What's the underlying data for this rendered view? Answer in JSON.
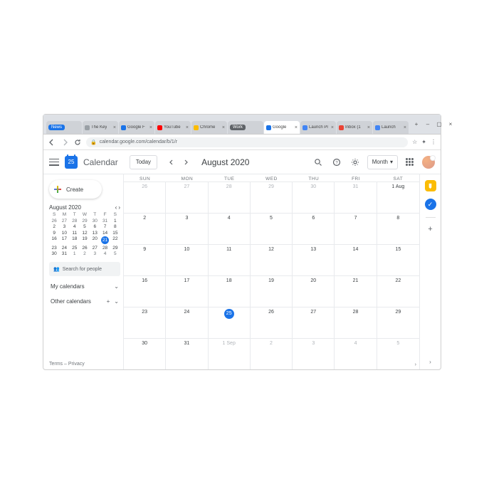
{
  "browser": {
    "tabs": [
      {
        "label": "News",
        "color": "#1a73e8",
        "textcolor": "#fff",
        "pill": true
      },
      {
        "label": "The Key",
        "favicon": "#9aa0a6",
        "close": "×"
      },
      {
        "label": "Google F",
        "favicon": "#1a73e8",
        "close": "×"
      },
      {
        "label": "YouTube",
        "favicon": "#ff0000",
        "close": "×"
      },
      {
        "label": "Chrome",
        "favicon": "#fbbc04",
        "close": "×"
      },
      {
        "label": "Work",
        "color": "#5f6368",
        "textcolor": "#fff",
        "pill": true
      },
      {
        "label": "Google",
        "favicon": "#1a73e8",
        "close": "×",
        "active": true
      },
      {
        "label": "Launch Pr",
        "favicon": "#4285f4",
        "close": "×"
      },
      {
        "label": "Inbox (1",
        "favicon": "#ea4335",
        "close": "×"
      },
      {
        "label": "Launch",
        "favicon": "#4285f4",
        "close": "×"
      }
    ],
    "newtab": "+",
    "win": {
      "min": "–",
      "max": "▢",
      "close": "×"
    },
    "url": "calendar.google.com/calendar/b/1/r",
    "star": "☆",
    "ext": "✦",
    "menu": "⋮"
  },
  "header": {
    "calendar_logo_date": "25",
    "title": "Calendar",
    "today": "Today",
    "period": "August 2020",
    "view": "Month",
    "dropdown": "▾"
  },
  "sidebar": {
    "create": "Create",
    "mini_month": "August 2020",
    "mini_days": [
      "S",
      "M",
      "T",
      "W",
      "T",
      "F",
      "S"
    ],
    "mini_cells": [
      {
        "t": "26"
      },
      {
        "t": "27"
      },
      {
        "t": "28"
      },
      {
        "t": "29"
      },
      {
        "t": "30"
      },
      {
        "t": "31"
      },
      {
        "t": "1",
        "cm": true
      },
      {
        "t": "2",
        "cm": true
      },
      {
        "t": "3",
        "cm": true
      },
      {
        "t": "4",
        "cm": true
      },
      {
        "t": "5",
        "cm": true
      },
      {
        "t": "6",
        "cm": true
      },
      {
        "t": "7",
        "cm": true
      },
      {
        "t": "8",
        "cm": true
      },
      {
        "t": "9",
        "cm": true
      },
      {
        "t": "10",
        "cm": true
      },
      {
        "t": "11",
        "cm": true
      },
      {
        "t": "12",
        "cm": true
      },
      {
        "t": "13",
        "cm": true
      },
      {
        "t": "14",
        "cm": true
      },
      {
        "t": "15",
        "cm": true
      },
      {
        "t": "16",
        "cm": true
      },
      {
        "t": "17",
        "cm": true
      },
      {
        "t": "18",
        "cm": true
      },
      {
        "t": "19",
        "cm": true
      },
      {
        "t": "20",
        "cm": true
      },
      {
        "t": "21",
        "today": true
      },
      {
        "t": "22",
        "cm": true
      },
      {
        "t": "23",
        "cm": true
      },
      {
        "t": "24",
        "cm": true
      },
      {
        "t": "25",
        "cm": true
      },
      {
        "t": "26",
        "cm": true
      },
      {
        "t": "27",
        "cm": true
      },
      {
        "t": "28",
        "cm": true
      },
      {
        "t": "29",
        "cm": true
      },
      {
        "t": "30",
        "cm": true
      },
      {
        "t": "31",
        "cm": true
      },
      {
        "t": "1"
      },
      {
        "t": "2"
      },
      {
        "t": "3"
      },
      {
        "t": "4"
      },
      {
        "t": "5"
      }
    ],
    "search_people": "Search for people",
    "my_cal": "My calendars",
    "other_cal": "Other calendars",
    "footer": "Terms – Privacy"
  },
  "grid": {
    "dayheads": [
      "SUN",
      "MON",
      "TUE",
      "WED",
      "THU",
      "FRI",
      "SAT"
    ],
    "weeks": [
      [
        {
          "t": "26",
          "dim": true
        },
        {
          "t": "27",
          "dim": true
        },
        {
          "t": "28",
          "dim": true
        },
        {
          "t": "29",
          "dim": true
        },
        {
          "t": "30",
          "dim": true
        },
        {
          "t": "31",
          "dim": true
        },
        {
          "t": "1 Aug"
        }
      ],
      [
        {
          "t": "2"
        },
        {
          "t": "3"
        },
        {
          "t": "4"
        },
        {
          "t": "5"
        },
        {
          "t": "6"
        },
        {
          "t": "7"
        },
        {
          "t": "8"
        }
      ],
      [
        {
          "t": "9"
        },
        {
          "t": "10"
        },
        {
          "t": "11"
        },
        {
          "t": "12"
        },
        {
          "t": "13"
        },
        {
          "t": "14"
        },
        {
          "t": "15"
        }
      ],
      [
        {
          "t": "16"
        },
        {
          "t": "17"
        },
        {
          "t": "18"
        },
        {
          "t": "19"
        },
        {
          "t": "20"
        },
        {
          "t": "21"
        },
        {
          "t": "22"
        }
      ],
      [
        {
          "t": "23"
        },
        {
          "t": "24"
        },
        {
          "t": "25",
          "today": true
        },
        {
          "t": "26"
        },
        {
          "t": "27"
        },
        {
          "t": "28"
        },
        {
          "t": "29"
        }
      ],
      [
        {
          "t": "30"
        },
        {
          "t": "31"
        },
        {
          "t": "1 Sep",
          "dim": true
        },
        {
          "t": "2",
          "dim": true
        },
        {
          "t": "3",
          "dim": true
        },
        {
          "t": "4",
          "dim": true
        },
        {
          "t": "5",
          "dim": true
        }
      ]
    ],
    "collapse": "‹",
    "expando": "›"
  }
}
